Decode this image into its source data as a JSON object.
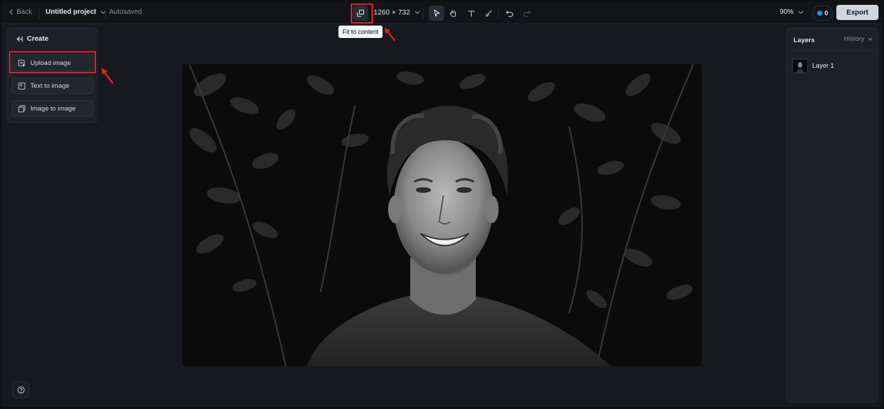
{
  "topbar": {
    "back_label": "Back",
    "project_title": "Untitled project",
    "autosave_status": "Autosaved",
    "canvas_size": "1260 × 732",
    "zoom": "90%",
    "credits": "0",
    "export_label": "Export",
    "fit_tooltip": "Fit to content",
    "tools": [
      "fit-to-content-icon",
      "select-arrow-icon",
      "hand-icon",
      "text-icon",
      "brush-icon",
      "undo-icon",
      "redo-icon"
    ]
  },
  "create_panel": {
    "heading": "Create",
    "items": [
      {
        "label": "Upload image",
        "icon": "upload-image-icon"
      },
      {
        "label": "Text to image",
        "icon": "text-to-image-icon"
      },
      {
        "label": "Image to image",
        "icon": "image-to-image-icon"
      }
    ]
  },
  "right_panel": {
    "tabs": {
      "layers": "Layers",
      "history": "History"
    },
    "layers": [
      {
        "name": "Layer 1"
      }
    ]
  },
  "colors": {
    "background": "#17191e",
    "panel": "#1d2026",
    "accent_highlight": "#e0202a",
    "export_button": "#cfd6e0",
    "credits_dot": "#3aa0e8"
  },
  "canvas": {
    "image": "black-and-white portrait of smiling young man with curly hair in front of leaves"
  }
}
